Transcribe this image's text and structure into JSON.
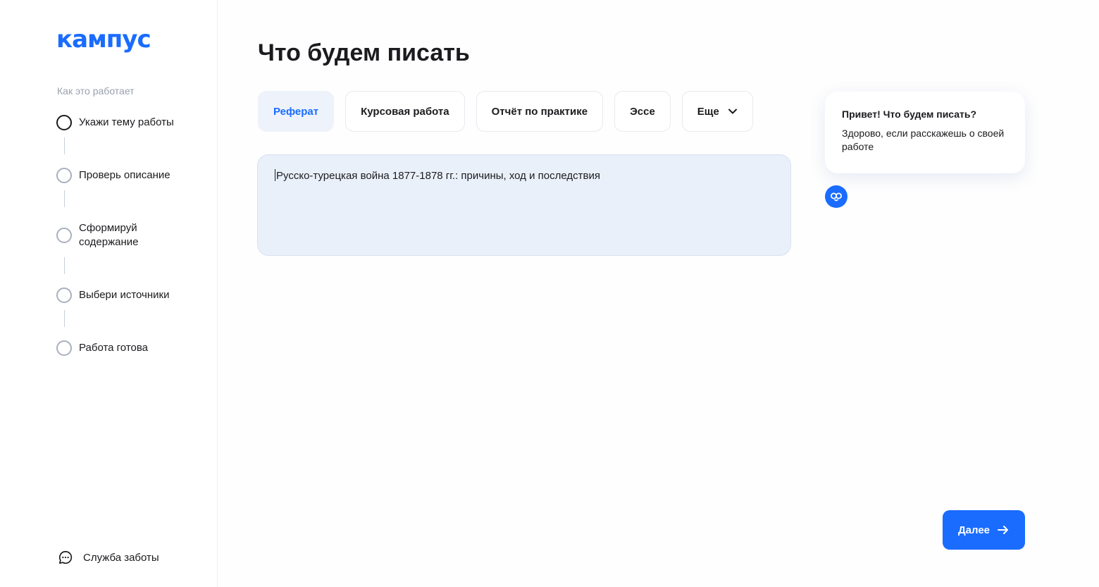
{
  "app": {
    "logo_text": "кампус",
    "brand_color": "#1a6cff"
  },
  "sidebar": {
    "how_it_works_label": "Как это работает",
    "steps": [
      {
        "label": "Укажи тему работы",
        "state": "current"
      },
      {
        "label": "Проверь описание",
        "state": "pending"
      },
      {
        "label": "Сформируй содержание",
        "state": "pending"
      },
      {
        "label": "Выбери источники",
        "state": "pending"
      },
      {
        "label": "Работа готова",
        "state": "pending"
      }
    ],
    "support": {
      "label": "Служба заботы",
      "icon": "chat-bubble-icon"
    }
  },
  "main": {
    "title": "Что будем писать",
    "tabs": [
      {
        "label": "Реферат",
        "selected": true
      },
      {
        "label": "Курсовая работа",
        "selected": false
      },
      {
        "label": "Отчёт по практике",
        "selected": false
      },
      {
        "label": "Эссе",
        "selected": false
      },
      {
        "label": "Еще",
        "selected": false,
        "icon": "chevron-down-icon"
      }
    ],
    "topic_input": {
      "value": "Русско-турецкая война 1877-1878 гг.: причины, ход и последствия"
    },
    "assistant": {
      "title": "Привет! Что будем писать?",
      "text": "Здорово, если расскажешь о своей работе",
      "avatar_icon": "assistant-logo-icon"
    },
    "next_button": {
      "label": "Далее",
      "icon": "arrow-right-icon"
    }
  }
}
